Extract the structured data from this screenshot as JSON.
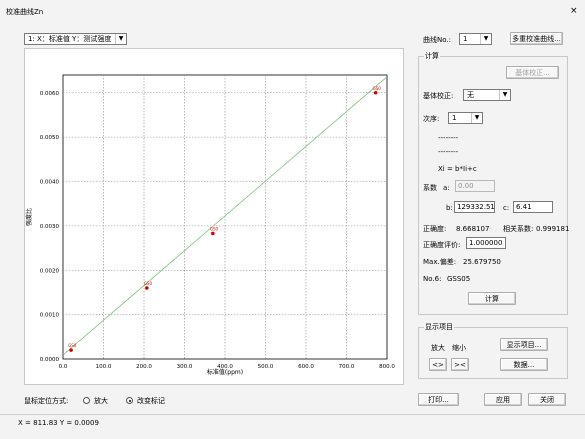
{
  "window": {
    "title": "校准曲线Zn",
    "close_glyph": "×"
  },
  "axis_selector": {
    "value": "1: X：标准值  Y：测试强度"
  },
  "curve_no": {
    "label": "曲线No.:",
    "value": "1"
  },
  "multi_curve_button": "多重校准曲线...",
  "calc_group": {
    "caption": "计算",
    "base_correction_button": "基体校正...",
    "base_correction_label": "基体校正:",
    "base_correction_value": "无",
    "order_label": "次序:",
    "order_value": "1",
    "dashes1": "--------",
    "dashes2": "--------",
    "formula": "Xi = b*Ii+c",
    "coef_label": "系数",
    "a_label": "a:",
    "a_value": "0.00",
    "b_label": "b:",
    "b_value": "129332.51",
    "c_label": "c:",
    "c_value": "6.41",
    "accuracy_label": "正确度:",
    "accuracy_value": "8.668107",
    "corr_label": "相关系数:",
    "corr_value": "0.999181",
    "accuracy_eval_label": "正确度评价:",
    "accuracy_eval_value": "1.000000",
    "max_dev_label": "Max.偏差:",
    "max_dev_value": "25.679750",
    "no_label": "No.6:",
    "no_value": "GSS05",
    "calc_button": "计算"
  },
  "display_group": {
    "caption": "显示项目",
    "zoom_in_label": "放大",
    "zoom_out_label": "缩小",
    "zoom_in_btn": "<>",
    "zoom_out_btn": "><",
    "display_items_button": "显示项目...",
    "data_button": "数据..."
  },
  "mouse_mode": {
    "label": "鼠标定位方式:",
    "options": [
      "放大",
      "改变标记"
    ],
    "selected": "改变标记"
  },
  "print_button": "打印...",
  "apply_button": "应用",
  "close_button": "关闭",
  "status_bar": "X =  811.83  Y =  0.0009",
  "chart_data": {
    "type": "scatter",
    "xlabel": "标准值(ppm)",
    "ylabel": "强度比",
    "xlim": [
      0,
      800
    ],
    "ylim": [
      0,
      0.0064
    ],
    "x_ticks": [
      "0.0",
      "100.0",
      "200.0",
      "300.0",
      "400.0",
      "500.0",
      "600.0",
      "700.0",
      "800.0"
    ],
    "y_ticks": [
      "0.0000",
      "0.0010",
      "0.0020",
      "0.0030",
      "0.0040",
      "0.0050",
      "0.0060"
    ],
    "grid": true,
    "points": [
      {
        "label": "GS0",
        "x": 20,
        "y": 0.0002
      },
      {
        "label": "GS0",
        "x": 207,
        "y": 0.0016
      },
      {
        "label": "GS0",
        "x": 370,
        "y": 0.00283
      },
      {
        "label": "GS0",
        "x": 772,
        "y": 0.006
      }
    ],
    "fit_line": {
      "x": [
        0,
        800
      ],
      "y": [
        9e-05,
        0.00636
      ]
    },
    "colors": {
      "points": "#d40000",
      "fit": "#7ec07e",
      "grid": "#8c8c8c"
    }
  }
}
